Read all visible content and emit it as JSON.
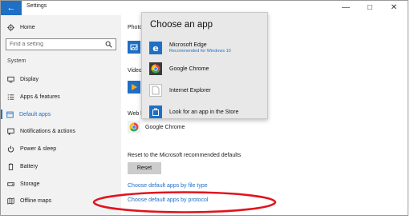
{
  "window": {
    "title": "Settings",
    "back_glyph": "←",
    "minimize_glyph": "—",
    "maximize_glyph": "☐",
    "close_glyph": "✕"
  },
  "sidebar": {
    "home_label": "Home",
    "search_placeholder": "Find a setting",
    "section_label": "System",
    "items": [
      {
        "label": "Display",
        "icon": "display-icon"
      },
      {
        "label": "Apps & features",
        "icon": "apps-features-icon"
      },
      {
        "label": "Default apps",
        "icon": "default-apps-icon",
        "active": true
      },
      {
        "label": "Notifications & actions",
        "icon": "notifications-icon"
      },
      {
        "label": "Power & sleep",
        "icon": "power-icon"
      },
      {
        "label": "Battery",
        "icon": "battery-icon"
      },
      {
        "label": "Storage",
        "icon": "storage-icon"
      },
      {
        "label": "Offline maps",
        "icon": "offline-maps-icon"
      }
    ]
  },
  "main": {
    "photo_label": "Photo",
    "video_label": "Video",
    "web_label": "Web b",
    "web_browser_name": "Google Chrome",
    "reset_text": "Reset to the Microsoft recommended defaults",
    "reset_button": "Reset",
    "link_file_type": "Choose default apps by file type",
    "link_protocol": "Choose default apps by protocol"
  },
  "flyout": {
    "title": "Choose an app",
    "items": [
      {
        "name": "Microsoft Edge",
        "sub": "Recommended for Windows 10",
        "icon": "edge-icon"
      },
      {
        "name": "Google Chrome",
        "sub": "",
        "icon": "chrome-icon"
      },
      {
        "name": "Internet Explorer",
        "sub": "",
        "icon": "internet-explorer-icon"
      },
      {
        "name": "Look for an app in the Store",
        "sub": "",
        "icon": "store-icon"
      }
    ]
  },
  "colors": {
    "accent": "#1f6fc5",
    "annotation": "#e0141e",
    "sidebar_bg": "#f2f2f2",
    "flyout_bg": "#e8e8e8"
  }
}
